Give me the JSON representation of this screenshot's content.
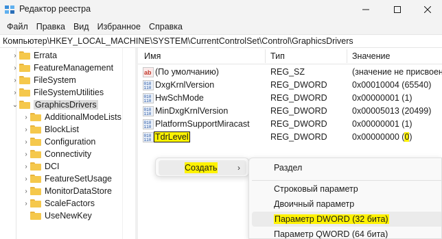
{
  "window": {
    "title": "Редактор реестра"
  },
  "menubar": [
    "Файл",
    "Правка",
    "Вид",
    "Избранное",
    "Справка"
  ],
  "address": "Компьютер\\HKEY_LOCAL_MACHINE\\SYSTEM\\CurrentControlSet\\Control\\GraphicsDrivers",
  "tree": {
    "items": [
      {
        "label": "Errata",
        "expanded": false
      },
      {
        "label": "FeatureManagement",
        "expanded": false
      },
      {
        "label": "FileSystem",
        "expanded": false
      },
      {
        "label": "FileSystemUtilities",
        "expanded": false
      },
      {
        "label": "GraphicsDrivers",
        "expanded": true,
        "selected": true
      },
      {
        "label": "AdditionalModeLists",
        "expanded": false
      },
      {
        "label": "BlockList",
        "expanded": false
      },
      {
        "label": "Configuration",
        "expanded": false
      },
      {
        "label": "Connectivity",
        "expanded": false
      },
      {
        "label": "DCI",
        "expanded": false
      },
      {
        "label": "FeatureSetUsage",
        "expanded": false
      },
      {
        "label": "MonitorDataStore",
        "expanded": false
      },
      {
        "label": "ScaleFactors",
        "expanded": false
      },
      {
        "label": "UseNewKey",
        "expanded": false
      }
    ]
  },
  "list": {
    "columns": {
      "name": "Имя",
      "type": "Тип",
      "value": "Значение"
    },
    "rows": [
      {
        "name": "(По умолчанию)",
        "type": "REG_SZ",
        "value": "(значение не присвоено)",
        "icon": "string-value-icon"
      },
      {
        "name": "DxgKrnlVersion",
        "type": "REG_DWORD",
        "value": "0x00010004 (65540)",
        "icon": "binary-value-icon"
      },
      {
        "name": "HwSchMode",
        "type": "REG_DWORD",
        "value": "0x00000001 (1)",
        "icon": "binary-value-icon"
      },
      {
        "name": "MinDxgKrnlVersion",
        "type": "REG_DWORD",
        "value": "0x00005013 (20499)",
        "icon": "binary-value-icon"
      },
      {
        "name": "PlatformSupportMiracast",
        "type": "REG_DWORD",
        "value": "0x00000001 (1)",
        "icon": "binary-value-icon"
      },
      {
        "name": "TdrLevel",
        "type": "REG_DWORD",
        "value_prefix": "0x00000000 (",
        "value_highlight": "0",
        "value_suffix": ")",
        "icon": "binary-value-icon"
      }
    ]
  },
  "context_menu": {
    "create_label": "Создать",
    "arrow": "›",
    "submenu": [
      "Раздел",
      "Строковый параметр",
      "Двоичный параметр",
      "Параметр DWORD (32 бита)",
      "Параметр QWORD (64 бита)"
    ],
    "highlight_color": "#fff200"
  },
  "colors": {
    "highlight": "#fff200",
    "folder": "#f5c84c",
    "chrome": "#f3f3f3"
  }
}
